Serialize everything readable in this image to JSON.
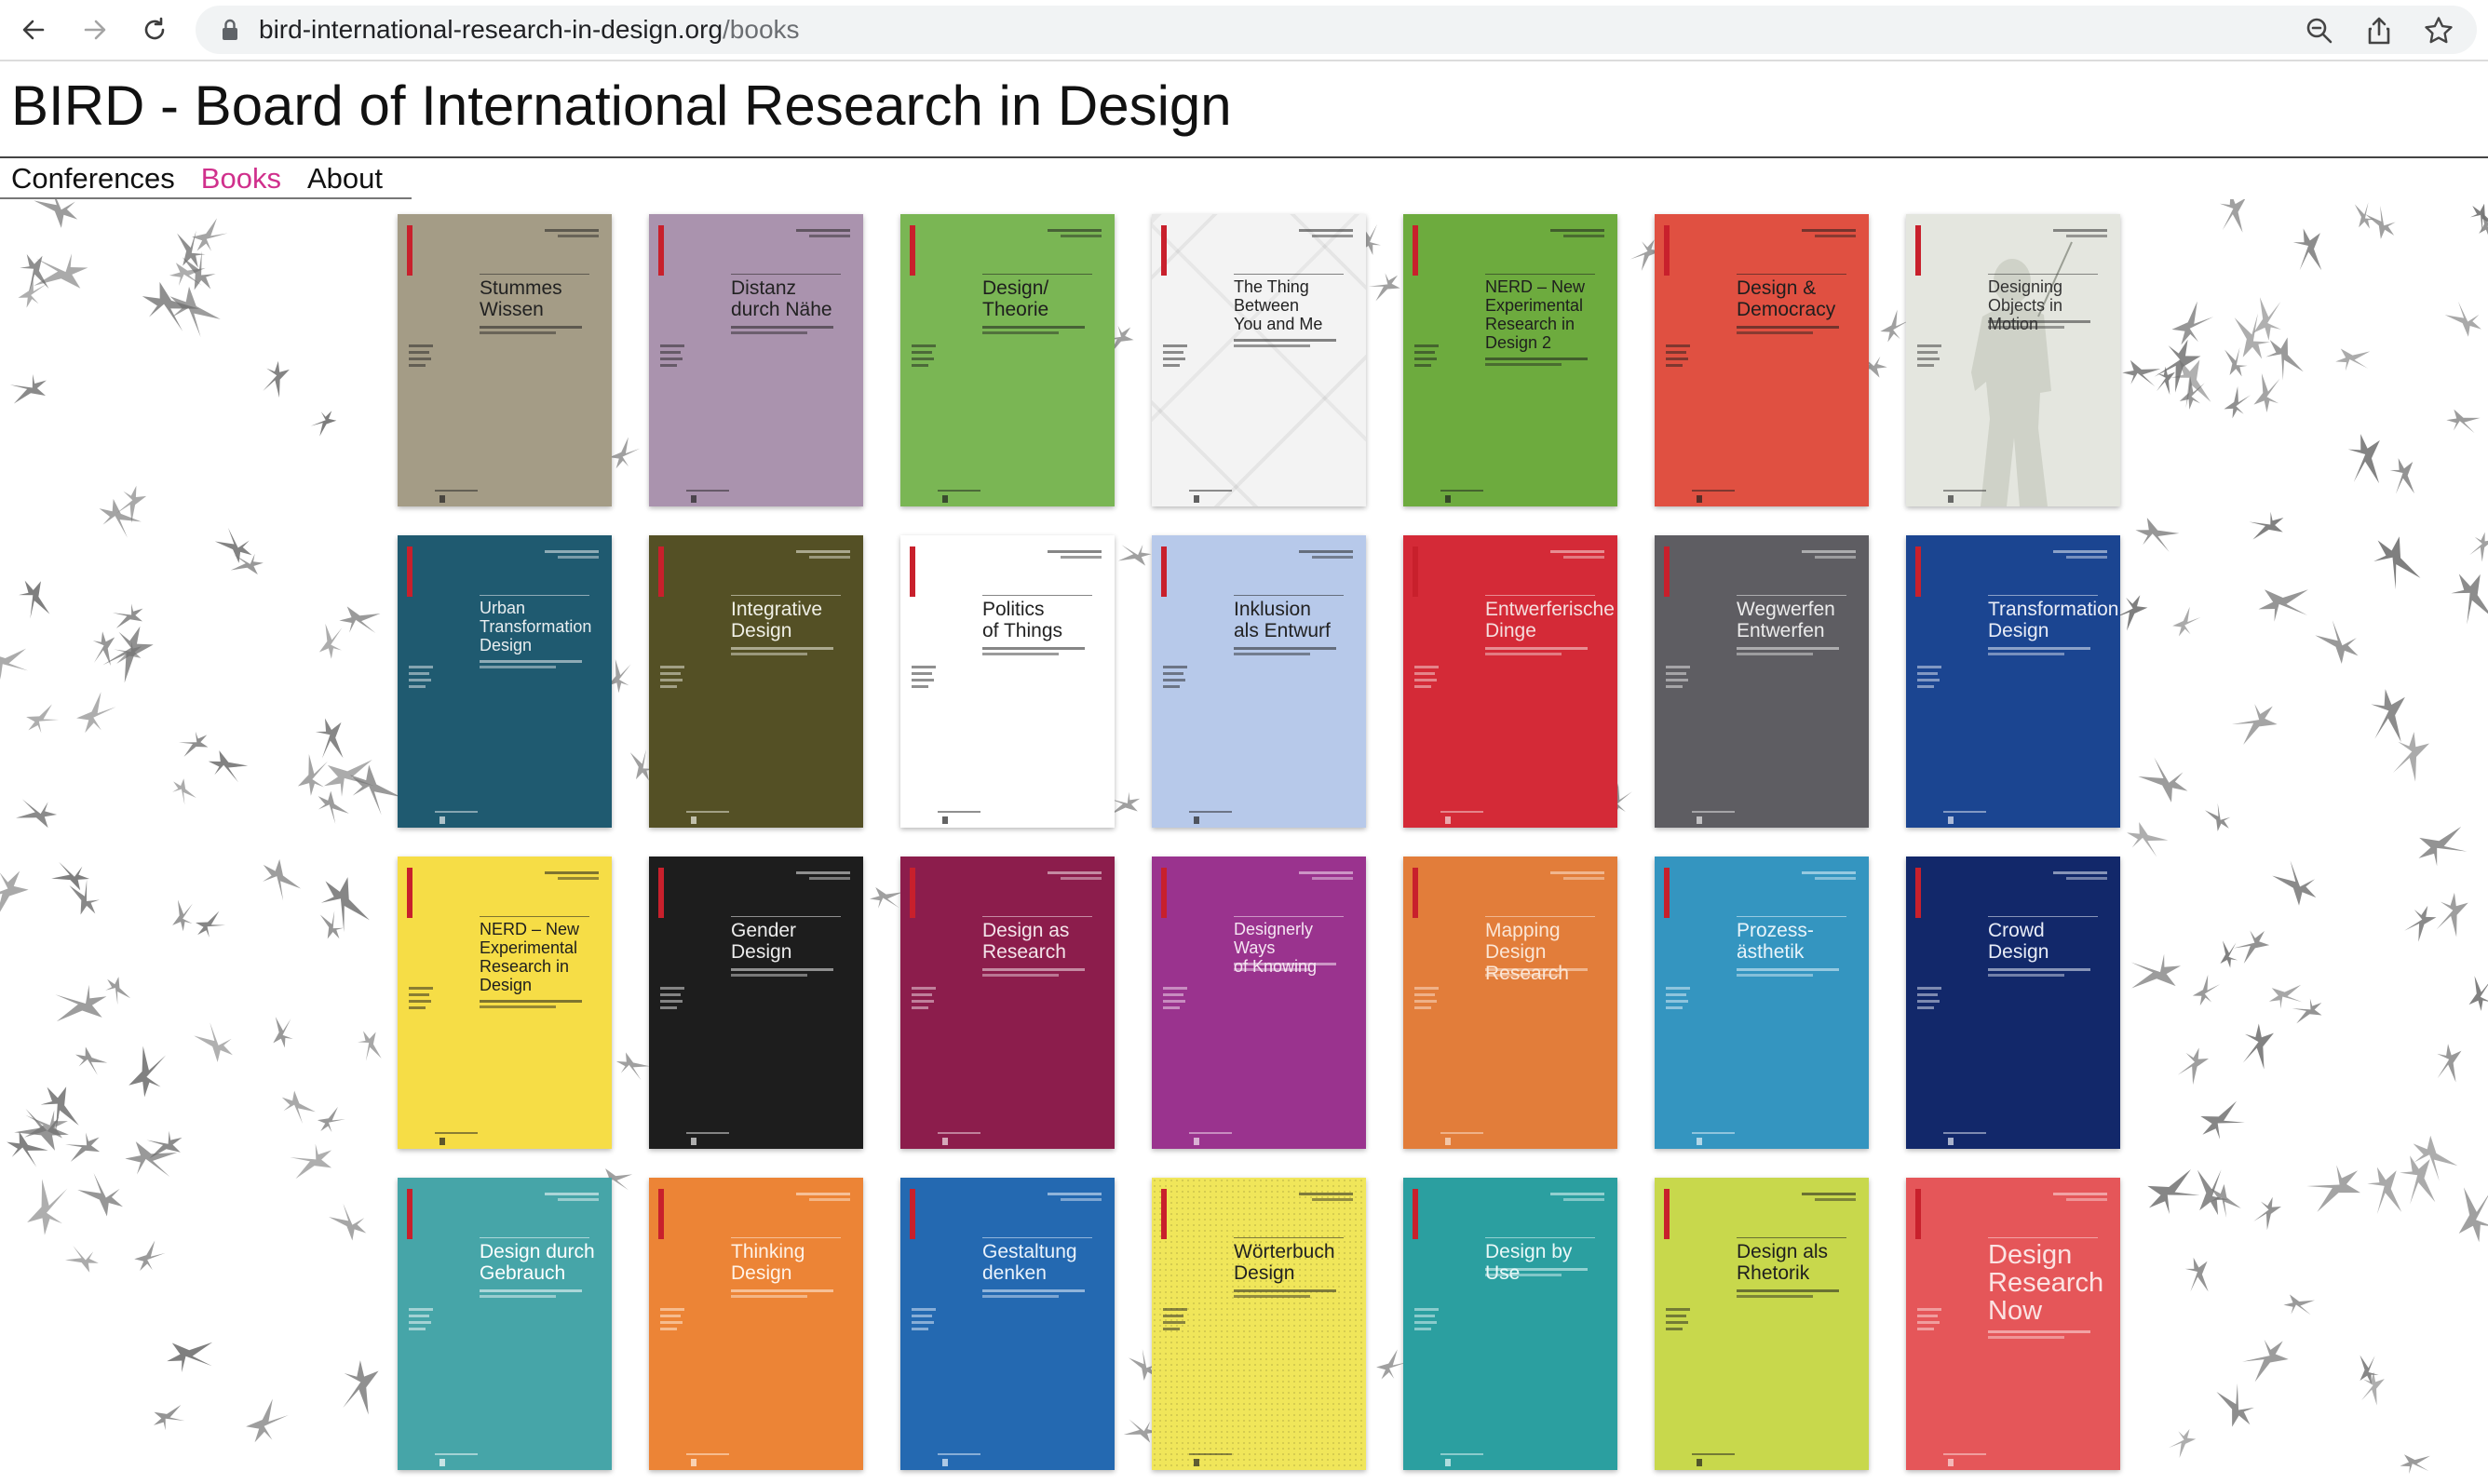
{
  "browser": {
    "url_domain": "bird-international-research-in-design.org",
    "url_path": "/books",
    "back_icon": "arrow-left-icon",
    "forward_icon": "arrow-right-icon",
    "reload_icon": "reload-icon",
    "lock_icon": "lock-icon",
    "zoom_icon": "zoom-icon",
    "share_icon": "share-icon",
    "bookmark_icon": "star-icon"
  },
  "site": {
    "title": "BIRD - Board of International Research in Design"
  },
  "nav": [
    {
      "label": "Conferences",
      "active": false
    },
    {
      "label": "Books",
      "active": true
    },
    {
      "label": "About",
      "active": false
    }
  ],
  "colors": {
    "accent": "#d0308c"
  },
  "books": [
    {
      "title": "Stummes\nWissen",
      "bg": "#a49c86",
      "fg": "#222222"
    },
    {
      "title": "Distanz\ndurch Nähe",
      "bg": "#aa93ae",
      "fg": "#222222"
    },
    {
      "title": "Design/\nTheorie",
      "bg": "#7ab654",
      "fg": "#1e1e1e"
    },
    {
      "title": "The Thing\nBetween\nYou and Me",
      "bg": "#f3f3f3",
      "fg": "#222222"
    },
    {
      "title": "NERD – New\nExperimental\nResearch in\nDesign 2",
      "bg": "#6dab3e",
      "fg": "#1e1e1e"
    },
    {
      "title": "Design &\nDemocracy",
      "bg": "#e05041",
      "fg": "#1e1e1e"
    },
    {
      "title": "Designing\nObjects in Motion",
      "bg": "#e4e6df",
      "fg": "#333333"
    },
    {
      "title": "Urban\nTransformation\nDesign",
      "bg": "#1f5a70",
      "fg": "#e9eef0"
    },
    {
      "title": "Integrative\nDesign",
      "bg": "#545025",
      "fg": "#f0f0e6"
    },
    {
      "title": "Politics\nof Things",
      "bg": "#ffffff",
      "fg": "#222222"
    },
    {
      "title": "Inklusion\nals Entwurf",
      "bg": "#b7c9ea",
      "fg": "#222222"
    },
    {
      "title": "Entwerferische\nDinge",
      "bg": "#d42a37",
      "fg": "#f5dede"
    },
    {
      "title": "Wegwerfen\nEntwerfen",
      "bg": "#5e5d62",
      "fg": "#ececec"
    },
    {
      "title": "Transformation\nDesign",
      "bg": "#1b4591",
      "fg": "#e8ecf6"
    },
    {
      "title": "NERD – New\nExperimental\nResearch in\nDesign",
      "bg": "#f6dd46",
      "fg": "#1e1e1e"
    },
    {
      "title": "Gender\nDesign",
      "bg": "#1d1d1d",
      "fg": "#ececec"
    },
    {
      "title": "Design as\nResearch",
      "bg": "#8c1d4c",
      "fg": "#f3e4ea"
    },
    {
      "title": "Designerly Ways\nof Knowing",
      "bg": "#9a338e",
      "fg": "#f5e5f2"
    },
    {
      "title": "Mapping Design\nResearch",
      "bg": "#e27d3a",
      "fg": "#fbe6d6"
    },
    {
      "title": "Prozess-\nästhetik",
      "bg": "#3495c0",
      "fg": "#e8f4fa"
    },
    {
      "title": "Crowd\nDesign",
      "bg": "#12286a",
      "fg": "#e8ecf6"
    },
    {
      "title": "Design durch\nGebrauch",
      "bg": "#46a5a8",
      "fg": "#ffffff"
    },
    {
      "title": "Thinking\nDesign",
      "bg": "#ec8436",
      "fg": "#fff3e8"
    },
    {
      "title": "Gestaltung\ndenken",
      "bg": "#2469b1",
      "fg": "#eaf2fb"
    },
    {
      "title": "Wörterbuch\nDesign",
      "bg": "#f0e65a",
      "fg": "#222222"
    },
    {
      "title": "Design by Use",
      "bg": "#2b9fa0",
      "fg": "#eaf8f8"
    },
    {
      "title": "Design als\nRhetorik",
      "bg": "#c8d84c",
      "fg": "#1e1e1e"
    },
    {
      "title": "Design\nResearch\nNow",
      "bg": "#e55659",
      "fg": "#fbe3e3"
    }
  ]
}
